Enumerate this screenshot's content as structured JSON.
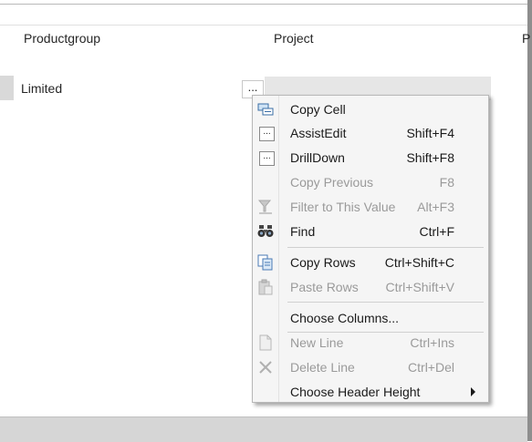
{
  "grid": {
    "columns": [
      "Productgroup",
      "Project",
      "P"
    ],
    "row": {
      "productgroup": "Limited",
      "assist_button_label": "..."
    }
  },
  "context_menu": {
    "items": [
      {
        "id": "copy-cell",
        "label": "Copy Cell",
        "shortcut": "",
        "icon": "copy-cell-icon",
        "disabled": false
      },
      {
        "id": "assist-edit",
        "label": "AssistEdit",
        "shortcut": "Shift+F4",
        "icon": "ellipsis-button-icon",
        "disabled": false
      },
      {
        "id": "drill-down",
        "label": "DrillDown",
        "shortcut": "Shift+F8",
        "icon": "ellipsis-button-icon",
        "disabled": false
      },
      {
        "id": "copy-previous",
        "label": "Copy Previous",
        "shortcut": "F8",
        "icon": "",
        "disabled": true
      },
      {
        "id": "filter-to-this-value",
        "label": "Filter to This Value",
        "shortcut": "Alt+F3",
        "icon": "filter-icon",
        "disabled": true
      },
      {
        "id": "find",
        "label": "Find",
        "shortcut": "Ctrl+F",
        "icon": "binoculars-icon",
        "disabled": false
      },
      {
        "id": "copy-rows",
        "label": "Copy Rows",
        "shortcut": "Ctrl+Shift+C",
        "icon": "copy-rows-icon",
        "disabled": false
      },
      {
        "id": "paste-rows",
        "label": "Paste Rows",
        "shortcut": "Ctrl+Shift+V",
        "icon": "paste-icon",
        "disabled": true
      },
      {
        "id": "choose-columns",
        "label": "Choose Columns...",
        "shortcut": "",
        "icon": "",
        "disabled": false
      },
      {
        "id": "new-line",
        "label": "New Line",
        "shortcut": "Ctrl+Ins",
        "icon": "new-document-icon",
        "disabled": true
      },
      {
        "id": "delete-line",
        "label": "Delete Line",
        "shortcut": "Ctrl+Del",
        "icon": "delete-x-icon",
        "disabled": true
      },
      {
        "id": "choose-header-height",
        "label": "Choose Header Height",
        "shortcut": "",
        "icon": "submenu-arrow-icon",
        "disabled": false
      }
    ]
  }
}
